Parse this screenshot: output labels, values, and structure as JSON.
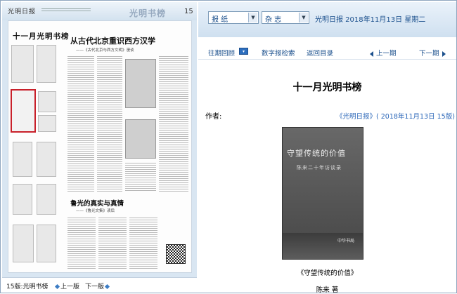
{
  "newspaper": {
    "masthead": "光明日报",
    "section": "光明书榜",
    "page_number": "15",
    "headline": "十一月光明书榜",
    "article1_title": "从古代北京重识西方汉学",
    "article1_subtitle": "——《古代北京与西方文明》漫谈",
    "article2_title": "鲁光的真实与真情",
    "article2_subtitle": "——《鲁光文集》读后"
  },
  "page_nav": {
    "current": "15版:光明书榜",
    "prev": "上一版",
    "next": "下一版"
  },
  "selectors": {
    "paper": "报 纸",
    "magazine": "杂 志"
  },
  "header_date": "光明日报  2018年11月13日  星期二",
  "nav": {
    "past_review": "往期回顾",
    "past_btn": "▾",
    "digital": "数字报检索",
    "back": "返回目录",
    "prev_article": "上一期",
    "next_article": "下一期"
  },
  "article": {
    "title": "十一月光明书榜",
    "author_label": "作者:",
    "source": "《光明日报》( 2018年11月13日  15版)",
    "cover_title": "守望传统的价值",
    "cover_subtitle": "陈来二十年访谈录",
    "cover_publisher": "中华书局",
    "caption": "《守望传统的价值》",
    "byline": "陈来  著"
  },
  "colors": {
    "link": "#1a4f8c",
    "selection": "#c8202a",
    "accent": "#3c7cc4"
  }
}
